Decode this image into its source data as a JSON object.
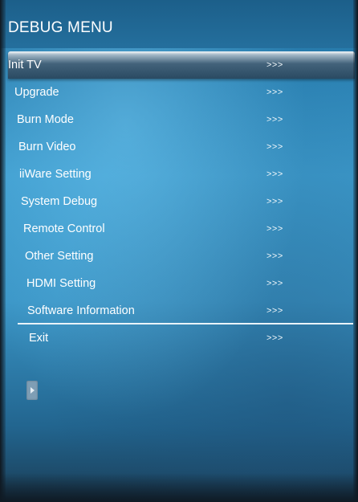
{
  "menu": {
    "title": "DEBUG MENU",
    "items": [
      {
        "label": "Init TV",
        "arrows": ">>>",
        "selected": true
      },
      {
        "label": "Upgrade",
        "arrows": ">>>",
        "selected": false
      },
      {
        "label": "Burn Mode",
        "arrows": ">>>",
        "selected": false
      },
      {
        "label": "Burn Video",
        "arrows": ">>>",
        "selected": false
      },
      {
        "label": "iiWare Setting",
        "arrows": ">>>",
        "selected": false
      },
      {
        "label": "System Debug",
        "arrows": ">>>",
        "selected": false
      },
      {
        "label": "Remote Control",
        "arrows": ">>>",
        "selected": false
      },
      {
        "label": "Other Setting",
        "arrows": ">>>",
        "selected": false
      },
      {
        "label": "HDMI Setting",
        "arrows": ">>>",
        "selected": false
      },
      {
        "label": "Software Information",
        "arrows": ">>>",
        "selected": false
      },
      {
        "label": "Exit",
        "arrows": ">>>",
        "selected": false
      }
    ]
  },
  "icons": {
    "side_tab": "expand-arrow-icon"
  },
  "colors": {
    "background": "#3a95c6",
    "title_bar": "#246f9d",
    "text": "#ffffff",
    "selection_highlight": "#43637b"
  }
}
